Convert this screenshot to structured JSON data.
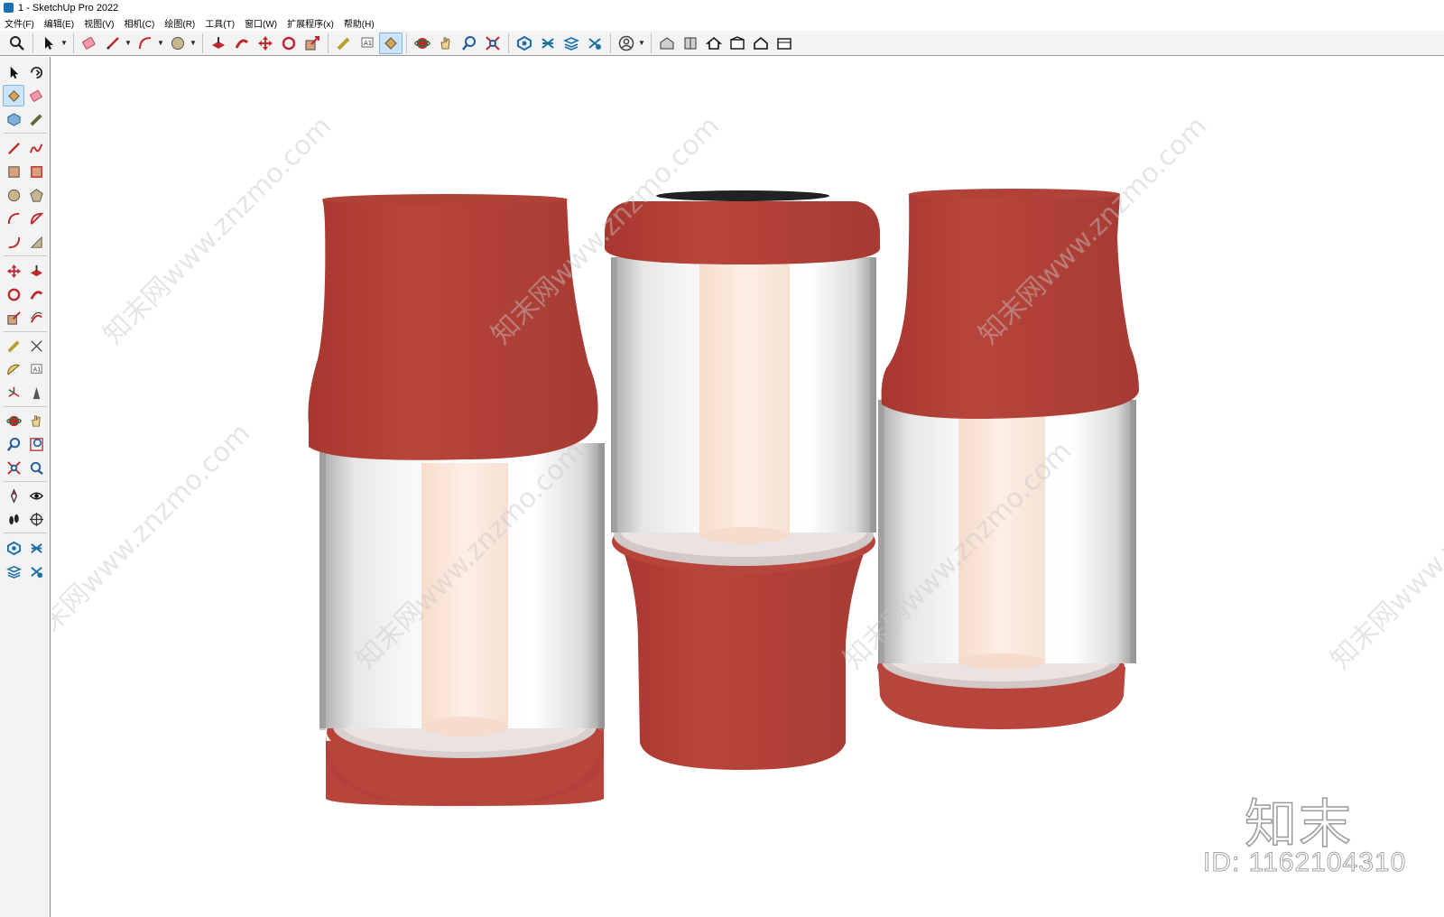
{
  "window": {
    "title": "1 - SketchUp Pro 2022"
  },
  "menu": [
    "文件(F)",
    "编辑(E)",
    "视图(V)",
    "相机(C)",
    "绘图(R)",
    "工具(T)",
    "窗口(W)",
    "扩展程序(x)",
    "帮助(H)"
  ],
  "toolbar_icons": [
    "search-icon",
    "select-icon",
    "eraser-icon",
    "pencil-icon",
    "arc-icon",
    "circle-icon",
    "pushpull-icon",
    "followme-icon",
    "move-icon",
    "rotate-icon",
    "scale-icon",
    "tape-icon",
    "text-icon",
    "paint-bucket-icon",
    "orbit-icon",
    "pan-icon",
    "zoom-icon",
    "zoom-extents-icon",
    "components-icon",
    "sections-icon",
    "layers-icon",
    "styles-icon",
    "account-icon",
    "warehouse-icon",
    "extension-warehouse-icon",
    "home-icon",
    "materials-icon",
    "outline-house-icon",
    "sandbox-icon"
  ],
  "left_toolbar_icons": [
    "select-icon",
    "orbit-icon",
    "paint-bucket-icon",
    "eraser-icon",
    "component-icon",
    "tag-icon",
    "line-icon",
    "freehand-icon",
    "rectangle-icon",
    "rotated-rect-icon",
    "circle-icon",
    "polygon-icon",
    "arc-icon",
    "pie-icon",
    "two-point-arc-icon",
    "three-point-arc-icon",
    "move-icon",
    "pushpull-icon",
    "rotate-icon",
    "followme-icon",
    "scale-icon",
    "offset-icon",
    "tape-icon",
    "dimension-icon",
    "protractor-icon",
    "text-icon",
    "axes-icon",
    "3d-text-icon",
    "orbit2-icon",
    "pan-icon",
    "zoom-icon",
    "zoom-window-icon",
    "zoom-extents-icon",
    "previous-view-icon",
    "position-camera-icon",
    "look-around-icon",
    "walk-icon",
    "section-plane-icon",
    "components-icon",
    "sections-icon",
    "layers-icon",
    "styles-icon"
  ],
  "watermark": {
    "brand": "知末",
    "id": "ID: 1162104310",
    "diagonal": "知末网www.znzmo.com"
  },
  "colors": {
    "vase_red": "#b8453b",
    "glass": "#e2e2e2",
    "lamp_core": "#fce9dd",
    "toolbar_bg": "#f3f3f3",
    "viewport_bg": "#ffffff"
  }
}
